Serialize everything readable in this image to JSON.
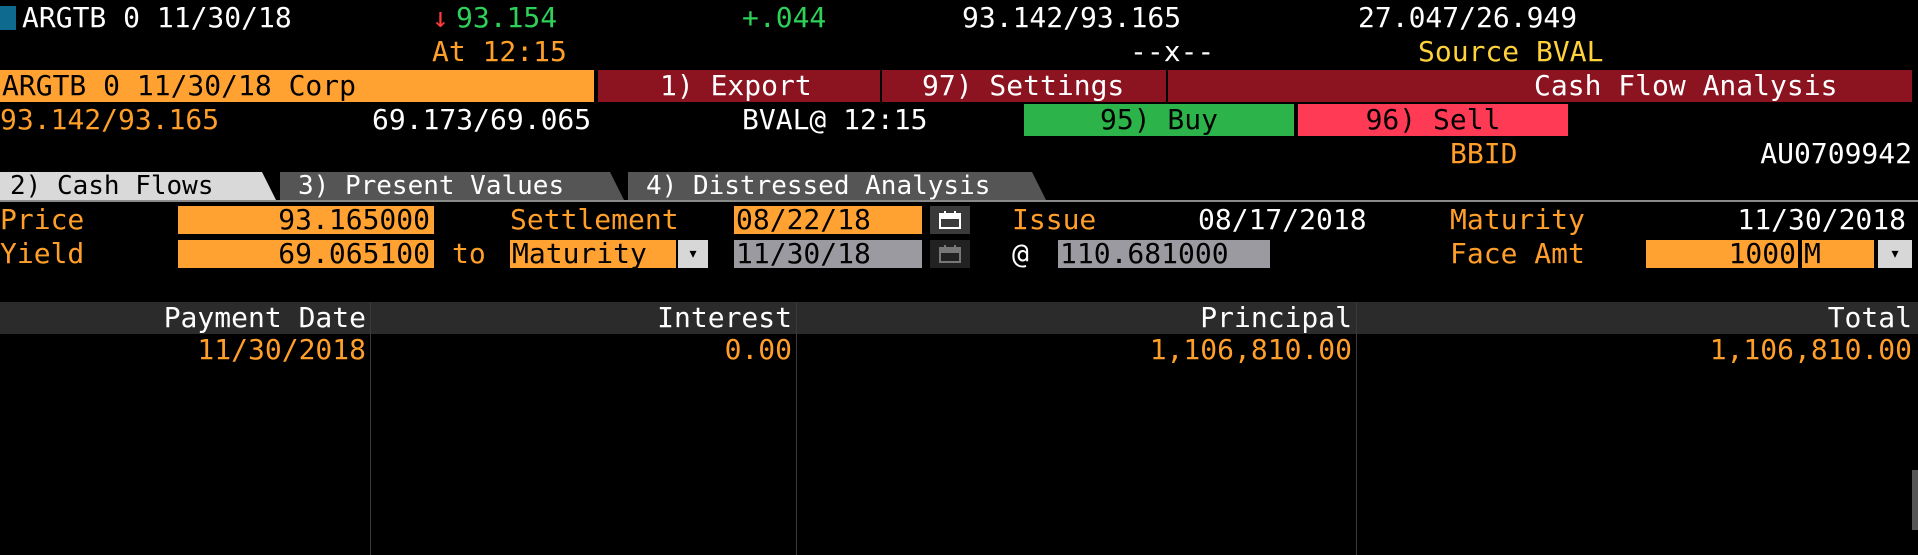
{
  "ticker_row": {
    "security": "ARGTB 0 11/30/18",
    "last_arrow": "↓",
    "last": "93.154",
    "change": "+.044",
    "bid_ask": "93.142/93.165",
    "yield_pair": "27.047/26.949",
    "time": "At 12:15",
    "bid_ask_size": "--x--",
    "source": "Source BVAL"
  },
  "title_bar": {
    "security_name": "ARGTB 0 11/30/18 Corp",
    "export": "1) Export",
    "settings": "97) Settings",
    "function_title": "Cash Flow Analysis"
  },
  "quote_row": {
    "price_pair": "93.142/93.165",
    "yield_pair": "69.173/69.065",
    "bval_time": "BVAL@ 12:15",
    "buy": "95) Buy",
    "sell": "96) Sell",
    "bbid_label": "BBID",
    "bbid_value": "AU0709942"
  },
  "tabs": [
    {
      "label": "2) Cash Flows",
      "active": true
    },
    {
      "label": "3) Present Values",
      "active": false
    },
    {
      "label": "4) Distressed Analysis",
      "active": false
    }
  ],
  "form": {
    "price_label": "Price",
    "price_value": "93.165000",
    "yield_label": "Yield",
    "yield_value": "69.065100",
    "to_label": "to",
    "to_value": "Maturity",
    "settlement_label": "Settlement",
    "settlement_value": "08/22/18",
    "workout_date": "11/30/18",
    "at_label": "@",
    "workout_price": "110.681000",
    "issue_label": "Issue",
    "issue_value": "08/17/2018",
    "maturity_label": "Maturity",
    "maturity_value": "11/30/2018",
    "face_label": "Face Amt",
    "face_value": "1000",
    "face_unit": "M"
  },
  "table": {
    "headers": [
      "Payment Date",
      "Interest",
      "Principal",
      "Total"
    ],
    "rows": [
      [
        "11/30/2018",
        "0.00",
        "1,106,810.00",
        "1,106,810.00"
      ]
    ]
  },
  "icons": {
    "calendar": "calendar-icon",
    "dropdown": "chevron-down-icon"
  }
}
